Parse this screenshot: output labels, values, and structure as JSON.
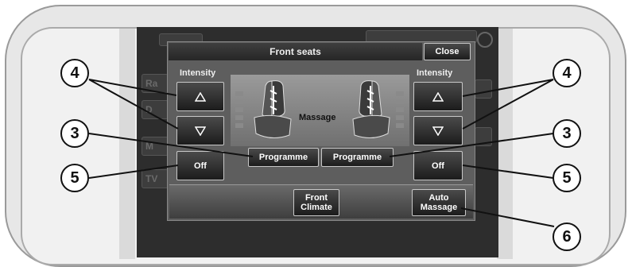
{
  "panel": {
    "title": "Front seats",
    "close_label": "Close",
    "center_label": "Massage"
  },
  "left_controls": {
    "intensity_label": "Intensity",
    "programme_label": "Programme",
    "off_label": "Off"
  },
  "right_controls": {
    "intensity_label": "Intensity",
    "programme_label": "Programme",
    "off_label": "Off"
  },
  "bottom_bar": {
    "front_climate_line1": "Front",
    "front_climate_line2": "Climate",
    "auto_massage_line1": "Auto",
    "auto_massage_line2": "Massage"
  },
  "background_tabs": [
    "Ra",
    "D",
    "M",
    "TV"
  ],
  "callouts": {
    "left_intensity": "4",
    "right_intensity": "4",
    "left_programme": "3",
    "right_programme": "3",
    "left_off": "5",
    "right_off": "5",
    "auto_massage": "6"
  },
  "icons": [
    "triangle-up-icon",
    "triangle-down-icon",
    "seat-icon",
    "clock-icon"
  ],
  "colors": {
    "panel": "#5e5e5e",
    "screen": "#2d2d2d",
    "button_border": "#c8c8c8"
  }
}
